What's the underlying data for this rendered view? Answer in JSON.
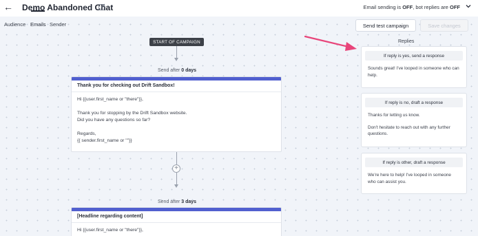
{
  "header": {
    "title": "Demo Abandoned Chat",
    "status_prefix": "Email sending is ",
    "status_email": "OFF",
    "status_middle": ", bot replies are ",
    "status_bot": "OFF"
  },
  "tabs": [
    {
      "label": "Audience",
      "active": false
    },
    {
      "label": "Emails",
      "active": true
    },
    {
      "label": "Sender",
      "active": false
    }
  ],
  "toolbar": {
    "send_test_label": "Send test campaign",
    "save_label": "Save changes"
  },
  "flow": {
    "start_label": "START OF CAMPAIGN",
    "steps": [
      {
        "send_prefix": "Send after ",
        "send_delay": "0 days",
        "subject": "Thank you for checking out Drift Sandbox!",
        "body": [
          "Hi {{user.first_name or \"there\"}},",
          "",
          "Thank you for stopping by the Drift Sandbox website.",
          "Did you have any questions so far?",
          "",
          "Regards,",
          "{{ sender.first_name or \"\"}}"
        ]
      },
      {
        "send_prefix": "Send after ",
        "send_delay": "3 days",
        "subject": "[Headline regarding content]",
        "body": [
          "Hi {{user.first_name or \"there\"}},"
        ]
      }
    ]
  },
  "replies": {
    "label": "Replies",
    "cards": [
      {
        "title": "If reply is yes, send a response",
        "body": [
          "Sounds great! I've looped in someone who can help."
        ]
      },
      {
        "title": "If reply is no, draft a response",
        "body": [
          "Thanks for letting us know.",
          "",
          "Don't hesitate to reach out with any further questions."
        ]
      },
      {
        "title": "If reply is other, draft a response",
        "body": [
          "We're here to help! I've looped in someone who can assist you."
        ]
      }
    ]
  },
  "colors": {
    "accent_bar": "#5160cf",
    "canvas_bg": "#f1f4f9",
    "annotation_arrow": "#e8457a"
  },
  "icons": [
    "back-arrow-icon",
    "pencil-edit-icon",
    "chevron-down-icon",
    "plus-circle-icon"
  ]
}
